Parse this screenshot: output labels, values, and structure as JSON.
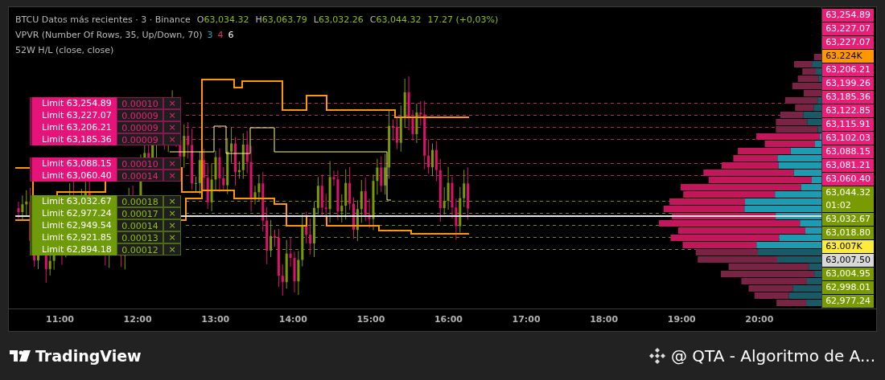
{
  "legend": {
    "symbol": "BTCU Datos más recientes · 3 · Binance",
    "ohlc": [
      {
        "label": "O",
        "value": "63,034.32"
      },
      {
        "label": "H",
        "value": "63,063.79"
      },
      {
        "label": "L",
        "value": "63,032.26"
      },
      {
        "label": "C",
        "value": "63,044.32"
      }
    ],
    "change": "17.27 (+0,03%)",
    "indicators": [
      {
        "name": "VPVR (Number Of Rows, 35, Up/Down, 70)",
        "values": [
          {
            "text": "3",
            "color": "#2aa8b8"
          },
          {
            "text": "4",
            "color": "#e8306f"
          },
          {
            "text": "6",
            "color": "#ffffff"
          }
        ]
      },
      {
        "name": "52W H/L (close, close)"
      }
    ]
  },
  "orders": [
    {
      "kind": "sell",
      "label": "Limit 63,254.89",
      "qty": "0.00010",
      "close": "×"
    },
    {
      "kind": "sell",
      "label": "Limit 63,227.07",
      "qty": "0.00009",
      "close": "×"
    },
    {
      "kind": "sell",
      "label": "Limit 63,206.21",
      "qty": "0.00009",
      "close": "×"
    },
    {
      "kind": "sell",
      "label": "Limit 63,185.36",
      "qty": "0.00009",
      "close": "×"
    },
    {
      "kind": "sell",
      "label": "Limit 63,088.15",
      "qty": "0.00010",
      "close": "×"
    },
    {
      "kind": "sell",
      "label": "Limit 63,060.40",
      "qty": "0.00014",
      "close": "×"
    },
    {
      "kind": "buy",
      "label": "Limit 63,032.67",
      "qty": "0.00018",
      "close": "×"
    },
    {
      "kind": "buy",
      "label": "Limit 62,977.24",
      "qty": "0.00017",
      "close": "×"
    },
    {
      "kind": "buy",
      "label": "Limit 62,949.54",
      "qty": "0.00014",
      "close": "×"
    },
    {
      "kind": "buy",
      "label": "Limit 62,921.85",
      "qty": "0.00013",
      "close": "×"
    },
    {
      "kind": "buy",
      "label": "Limit 62,894.18",
      "qty": "0.00012",
      "close": "×"
    }
  ],
  "price_axis": [
    {
      "text": "63,254.89",
      "color": "#e91e78"
    },
    {
      "text": "63,227.07",
      "color": "#e91e78"
    },
    {
      "text": "63,227.07",
      "color": "#e91e78"
    },
    {
      "text": "63.224K",
      "color": "#ff9800"
    },
    {
      "text": "63,206.21",
      "color": "#e91e78"
    },
    {
      "text": "63,199.26",
      "color": "#e91e78"
    },
    {
      "text": "63,185.36",
      "color": "#e91e78"
    },
    {
      "text": "63,122.85",
      "color": "#e91e78"
    },
    {
      "text": "63,115.91",
      "color": "#e91e78"
    },
    {
      "text": "63,102.03",
      "color": "#e91e78"
    },
    {
      "text": "63,088.15",
      "color": "#e91e78"
    },
    {
      "text": "63,081.21",
      "color": "#e91e78"
    },
    {
      "text": "63,060.40",
      "color": "#e91e78"
    },
    {
      "text": "63,044.32",
      "sub": "01:02",
      "color": "#7a9a01"
    },
    {
      "text": "63,032.67",
      "color": "#7a9a01"
    },
    {
      "text": "63,018.80",
      "color": "#7a9a01"
    },
    {
      "text": "63.007K",
      "color": "#ffeb3b"
    },
    {
      "text": "63,007.50",
      "color": "#d9d9d9"
    },
    {
      "text": "63,004.95",
      "color": "#7a9a01"
    },
    {
      "text": "62,998.01",
      "color": "#7a9a01"
    },
    {
      "text": "62,977.24",
      "color": "#7a9a01"
    }
  ],
  "time_axis": [
    "11:00",
    "12:00",
    "13:00",
    "14:00",
    "15:00",
    "16:00",
    "17:00",
    "18:00",
    "19:00",
    "20:00"
  ],
  "footer": {
    "brand": "TradingView",
    "author": "@ QTA - Algoritmo de A..."
  }
}
